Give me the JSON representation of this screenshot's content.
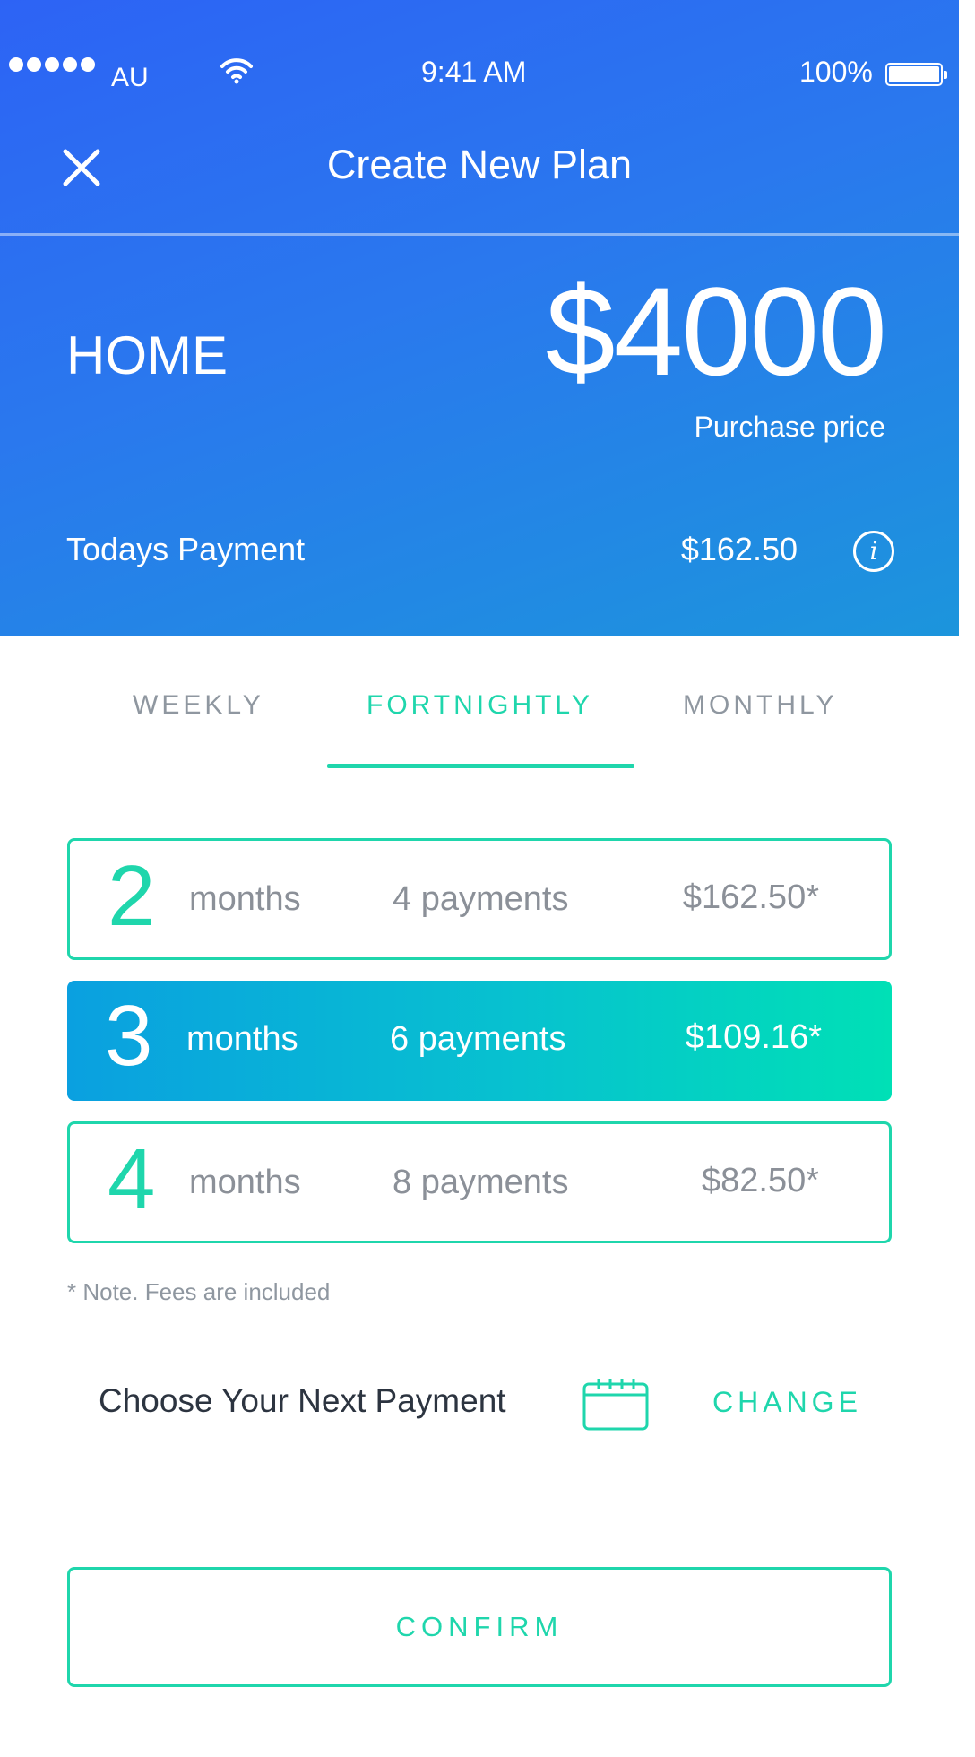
{
  "status_bar": {
    "carrier": "AU",
    "time": "9:41 AM",
    "battery": "100%",
    "icons": [
      "signal-dots",
      "wifi-icon",
      "battery-icon"
    ]
  },
  "nav": {
    "title": "Create New Plan",
    "close_icon": "close-icon"
  },
  "plan": {
    "name": "HOME",
    "price": "$4000",
    "price_label": "Purchase price",
    "todays_payment_label": "Todays Payment",
    "todays_payment_value": "$162.50",
    "info_icon": "info-icon"
  },
  "tabs": [
    {
      "label": "WEEKLY",
      "active": false
    },
    {
      "label": "FORTNIGHTLY",
      "active": true
    },
    {
      "label": "MONTHLY",
      "active": false
    }
  ],
  "options": [
    {
      "number": "2",
      "unit": "months",
      "payments": "4 payments",
      "amount": "$162.50*",
      "selected": false
    },
    {
      "number": "3",
      "unit": "months",
      "payments": "6 payments",
      "amount": "$109.16*",
      "selected": true
    },
    {
      "number": "4",
      "unit": "months",
      "payments": "8 payments",
      "amount": "$82.50*",
      "selected": false
    }
  ],
  "note": "* Note. Fees are included",
  "next_payment": {
    "label": "Choose Your Next Payment",
    "calendar_icon": "calendar-icon",
    "change_label": "CHANGE"
  },
  "confirm_label": "CONFIRM",
  "colors": {
    "hero_gradient_start": "#2d63f5",
    "hero_gradient_end": "#1c95dc",
    "accent": "#1fd6ac",
    "muted_text": "#8f97a0",
    "dark_text": "#2c3440"
  }
}
